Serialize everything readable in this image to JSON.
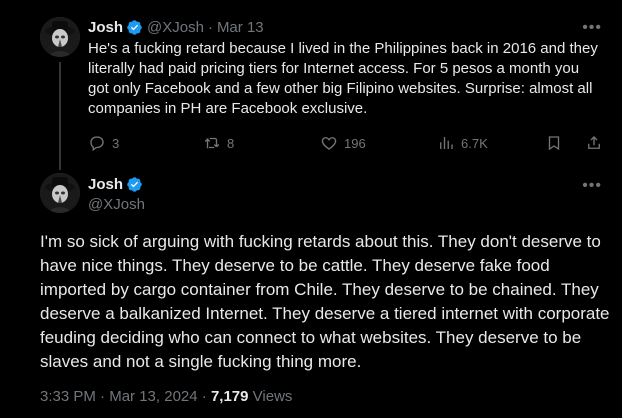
{
  "colors": {
    "background": "#000000",
    "text_primary": "#e7e9ea",
    "text_secondary": "#71767b",
    "verified_badge": "#1d9bf0",
    "divider": "#333639"
  },
  "parent_tweet": {
    "display_name": "Josh",
    "handle": "@XJosh",
    "separator": "·",
    "date": "Mar 13",
    "more_icon": "more-horizontal-icon",
    "text": "He's a fucking retard because I lived in the Philippines back in 2016 and they literally had paid pricing tiers for Internet access. For 5 pesos a month you got only Facebook and a few other big Filipino websites. Surprise: almost all companies in PH are Facebook exclusive.",
    "actions": {
      "reply_count": "3",
      "retweet_count": "8",
      "like_count": "196",
      "views_count": "6.7K"
    }
  },
  "main_tweet": {
    "display_name": "Josh",
    "handle": "@XJosh",
    "more_icon": "more-horizontal-icon",
    "text": "I'm so sick of arguing with fucking retards about this. They don't deserve to have nice things. They deserve to be cattle. They deserve fake food imported by cargo container from Chile. They deserve to be chained. They deserve a balkanized Internet. They deserve a tiered internet with corporate feuding deciding who can connect to what websites. They deserve to be slaves and not a single fucking thing more.",
    "time": "3:33 PM",
    "meta_separator": "·",
    "date": "Mar 13, 2024",
    "views_count": "7,179",
    "views_label": "Views"
  }
}
